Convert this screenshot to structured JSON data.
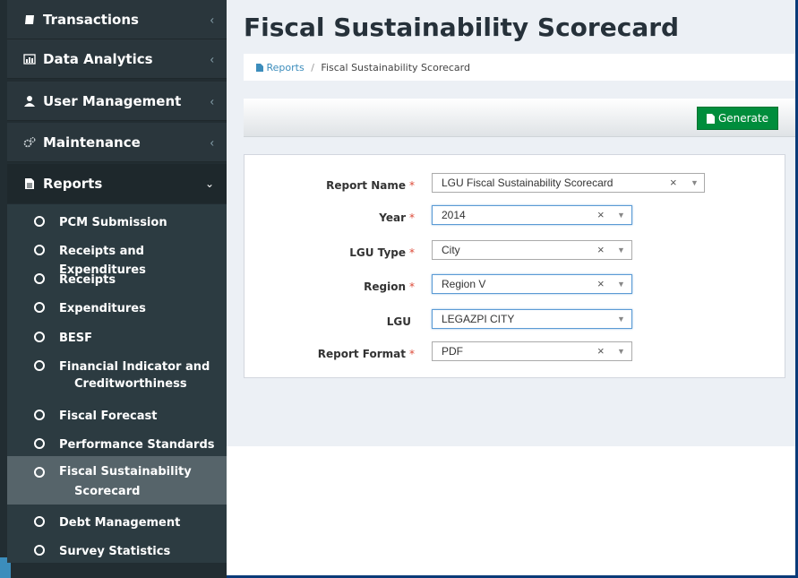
{
  "sidebar": {
    "nav": [
      {
        "label": "Transactions",
        "icon": "edit-icon"
      },
      {
        "label": "Data Analytics",
        "icon": "bar-chart-icon"
      },
      {
        "label": "User Management",
        "icon": "user-icon"
      },
      {
        "label": "Maintenance",
        "icon": "gears-icon"
      },
      {
        "label": "Reports",
        "icon": "file-icon"
      }
    ],
    "reports_submenu": [
      "PCM Submission",
      "Receipts and Expenditures",
      "Receipts",
      "Expenditures",
      "BESF",
      "Financial Indicator and",
      "Creditworthiness",
      "Fiscal Forecast",
      "Performance Standards",
      "Fiscal Sustainability",
      "Scorecard",
      "Debt Management",
      "Survey Statistics"
    ]
  },
  "header": {
    "title": "Fiscal Sustainability Scorecard",
    "breadcrumb": {
      "home": "Reports",
      "current": "Fiscal Sustainability Scorecard"
    }
  },
  "toolbar": {
    "generate_label": "Generate"
  },
  "form": {
    "fields": [
      {
        "label": "Report Name",
        "required": "*",
        "value": "LGU Fiscal Sustainability Scorecard"
      },
      {
        "label": "Year",
        "required": "*",
        "value": "2014"
      },
      {
        "label": "LGU Type",
        "required": "*",
        "value": "City"
      },
      {
        "label": "Region",
        "required": "*",
        "value": "Region V"
      },
      {
        "label": "LGU",
        "required": "",
        "value": "LEGAZPI CITY"
      },
      {
        "label": "Report Format",
        "required": "*",
        "value": "PDF"
      }
    ],
    "clear_glyph": "×",
    "arrow_glyph": "▼"
  },
  "colors": {
    "sidebar_bg": "#222d32",
    "sidebar_active_sub": "#56646a",
    "generate_btn": "#008d3c",
    "required_mark": "#dd4b39",
    "link": "#3c8dbc"
  }
}
